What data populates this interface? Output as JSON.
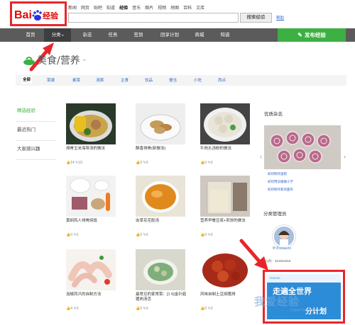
{
  "header": {
    "logo_text": "Bai",
    "logo_suffix": "经验",
    "nav": [
      "新闻",
      "网页",
      "贴吧",
      "知道",
      "经验",
      "音乐",
      "图片",
      "视频",
      "地图",
      "百科",
      "文库"
    ],
    "search_button": "搜索经验",
    "help_link": "帮助"
  },
  "navbar": {
    "items": [
      "首页",
      "分类",
      "杂志",
      "任务",
      "签到",
      "回享计划",
      "商城",
      "知道"
    ],
    "publish": "发布经验"
  },
  "category": {
    "title": "美食/营养",
    "tabs": [
      "全部",
      "菜谱",
      "素菜",
      "汤粥",
      "主食",
      "饮品",
      "便当",
      "小吃",
      "西点"
    ]
  },
  "sidebar": {
    "items": [
      "精选经验",
      "最近热门",
      "大家感兴趣"
    ]
  },
  "cards": [
    {
      "title": "排骨玉米海带汤的做法",
      "likes": "14",
      "comments": "10"
    },
    {
      "title": "酥香排骨(新做法)",
      "likes": "0",
      "comments": "0"
    },
    {
      "title": "牛肉丸汤粉的做法",
      "likes": "0",
      "comments": "0"
    },
    {
      "title": "黄焖鸡人排骨焖饭",
      "likes": "0",
      "comments": "0"
    },
    {
      "title": "虫草花花胶汤",
      "likes": "0",
      "comments": "0"
    },
    {
      "title": "营养早餐豆浆+煎饼的做法",
      "likes": "0",
      "comments": "0"
    },
    {
      "title": "泡椒凤爪的自制方法",
      "likes": "4",
      "comments": "0"
    },
    {
      "title": "最常见的家常菜：[1 6]金针菇猪肉汤怎",
      "likes": "0",
      "comments": "0"
    },
    {
      "title": "风味自制土豆焖猪排",
      "likes": "0",
      "comments": "0"
    }
  ],
  "panel": {
    "magazine_title": "优质杂志",
    "magazine_links": [
      "如何制作蛋糕",
      "如何用日跟做小学",
      "如何制作新的面布"
    ],
    "admin_title": "分类管理员",
    "admin_name": "叶子3211123",
    "qq_label": "QQ群：",
    "qq_value": "321634316",
    "ad_top": "ricecoo",
    "ad_text": "走遍全世界",
    "ad_sub": "分计划"
  },
  "watermark": {
    "text": "我爱经验",
    "sub": "jingyan.baidu.com"
  },
  "colors": {
    "accent_green": "#3cb043",
    "nav_gray": "#5b5b5b",
    "highlight_red": "#e8262a",
    "link_blue": "#3366cc"
  }
}
